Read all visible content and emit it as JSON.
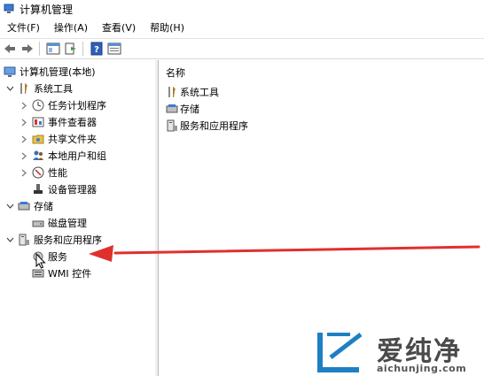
{
  "window": {
    "title": "计算机管理"
  },
  "menu": [
    {
      "id": "file",
      "label": "文件(F)"
    },
    {
      "id": "action",
      "label": "操作(A)"
    },
    {
      "id": "view",
      "label": "查看(V)"
    },
    {
      "id": "help",
      "label": "帮助(H)"
    }
  ],
  "toolbar": {
    "back_icon": "back-arrow-icon",
    "forward_icon": "forward-arrow-icon",
    "console_icon": "console-tree-icon",
    "export_icon": "export-list-icon",
    "help_icon": "help-icon",
    "properties_icon": "properties-icon"
  },
  "tree": {
    "root": "计算机管理(本地)",
    "system_tools": "系统工具",
    "task_scheduler": "任务计划程序",
    "event_viewer": "事件查看器",
    "shared_folders": "共享文件夹",
    "local_users": "本地用户和组",
    "performance": "性能",
    "device_manager": "设备管理器",
    "storage": "存储",
    "disk_management": "磁盘管理",
    "services_apps": "服务和应用程序",
    "services": "服务",
    "wmi": "WMI 控件"
  },
  "list": {
    "header": "名称",
    "items": [
      "系统工具",
      "存储",
      "服务和应用程序"
    ]
  },
  "watermark": {
    "title": "爱纯净",
    "url": "aichunjing.com"
  },
  "colors": {
    "arrow": "#e0302e",
    "logo": "#1e7fc4"
  }
}
